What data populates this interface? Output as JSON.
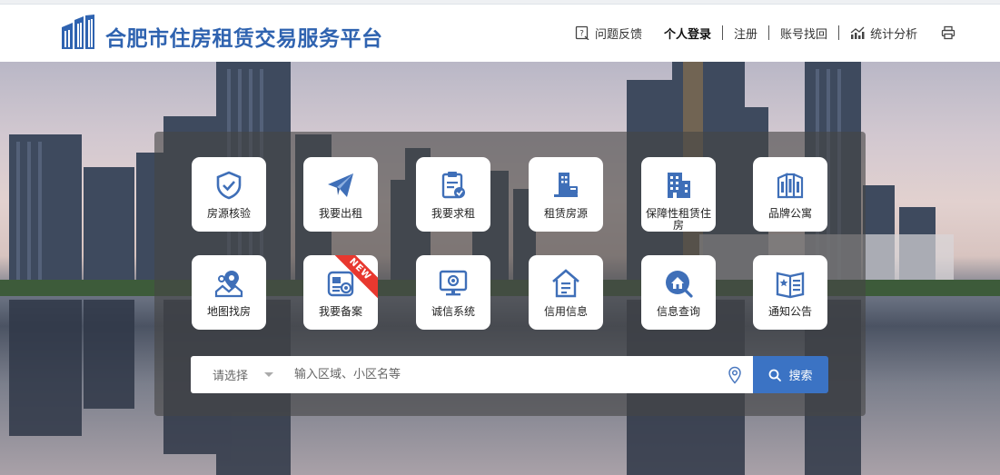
{
  "brand": {
    "title": "合肥市住房租赁交易服务平台",
    "logo_icon": "building-logo-icon",
    "color": "#2f63b0"
  },
  "nav": {
    "feedback": "问题反馈",
    "login": "个人登录",
    "register": "注册",
    "recover": "账号找回",
    "stats": "统计分析"
  },
  "tiles": [
    {
      "label": "房源核验",
      "icon": "shield-check-icon"
    },
    {
      "label": "我要出租",
      "icon": "paper-plane-icon"
    },
    {
      "label": "我要求租",
      "icon": "clipboard-check-icon"
    },
    {
      "label": "租赁房源",
      "icon": "building-desk-icon"
    },
    {
      "label": "保障性租赁住房",
      "icon": "office-building-icon"
    },
    {
      "label": "品牌公寓",
      "icon": "apartment-icon"
    },
    {
      "label": "地图找房",
      "icon": "map-pin-icon"
    },
    {
      "label": "我要备案",
      "icon": "record-card-icon",
      "badge": "NEW"
    },
    {
      "label": "诚信系统",
      "icon": "monitor-icon"
    },
    {
      "label": "信用信息",
      "icon": "house-document-icon"
    },
    {
      "label": "信息查询",
      "icon": "house-search-icon"
    },
    {
      "label": "通知公告",
      "icon": "notice-book-icon"
    }
  ],
  "search": {
    "select_label": "请选择",
    "placeholder": "输入区域、小区名等",
    "button_label": "搜索"
  },
  "colors": {
    "accent": "#3b73c4",
    "icon": "#3f6fb8",
    "badge": "#e8382f"
  }
}
